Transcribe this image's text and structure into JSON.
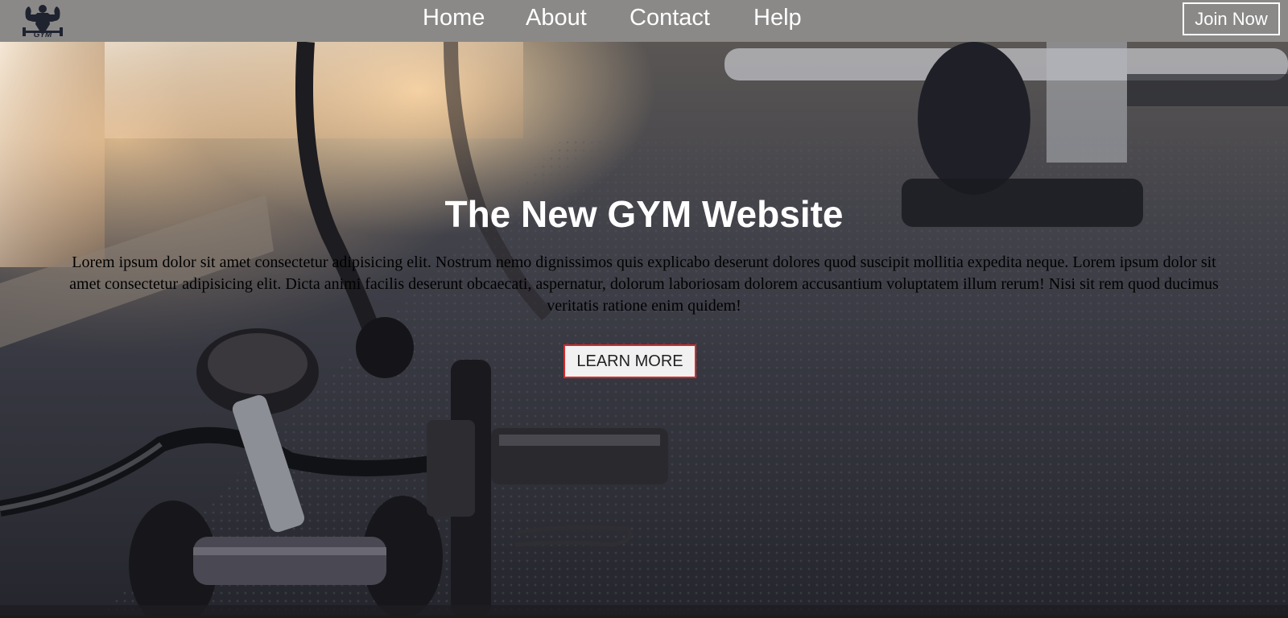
{
  "nav": {
    "logo_text": "GYM",
    "links": [
      "Home",
      "About",
      "Contact",
      "Help"
    ],
    "join_label": "Join Now"
  },
  "hero": {
    "title": "The New GYM Website",
    "paragraph": "Lorem ipsum dolor sit amet consectetur adipisicing elit. Nostrum nemo dignissimos quis explicabo deserunt dolores quod suscipit mollitia expedita neque. Lorem ipsum dolor sit amet consectetur adipisicing elit. Dicta animi facilis deserunt obcaecati, aspernatur, dolorum laboriosam dolorem accusantium voluptatem illum rerum! Nisi sit rem quod ducimus veritatis ratione enim quidem!",
    "button_label": "LEARN MORE"
  },
  "colors": {
    "navbar": "#8a8988",
    "button_border": "#d62a2a",
    "text_white": "#ffffff"
  },
  "icons": [
    "bodybuilder-logo-icon"
  ]
}
